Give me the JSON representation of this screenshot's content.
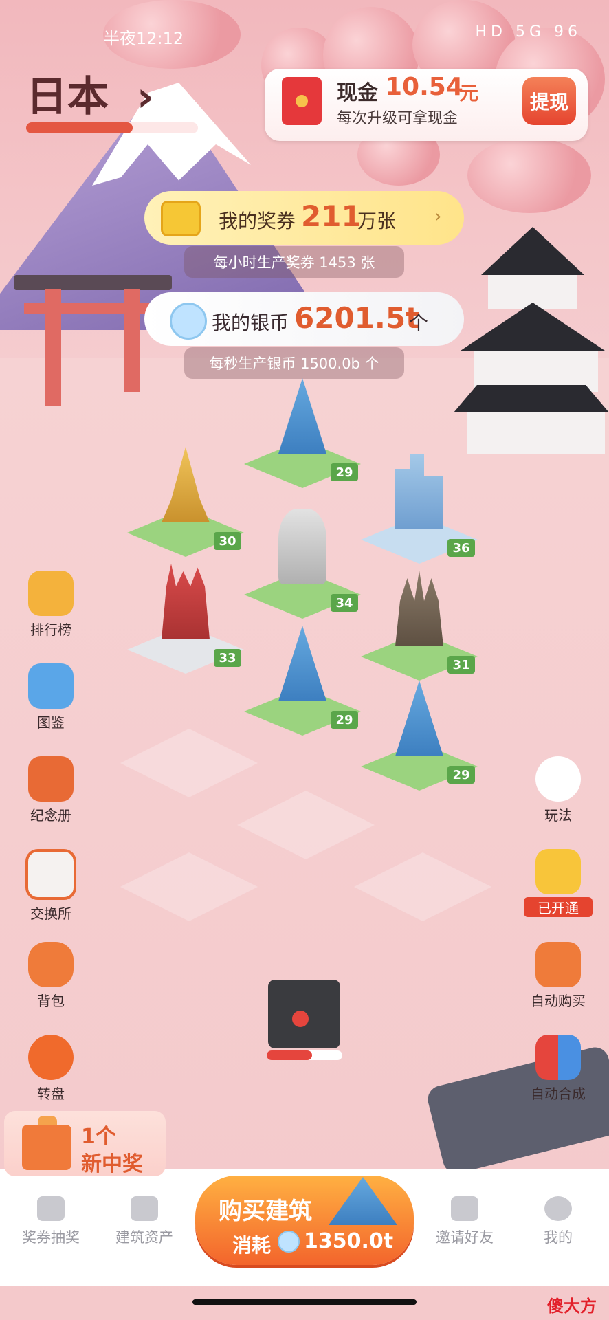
{
  "status_bar": {
    "time": "半夜12:12",
    "icons": "HD 5G 96"
  },
  "header": {
    "country": "日本",
    "arrow": "›",
    "progress": 0.62
  },
  "cash": {
    "label": "现金",
    "amount": "10.54",
    "unit": "元",
    "subtitle": "每次升级可拿现金",
    "withdraw_label": "提现"
  },
  "vouchers": {
    "label": "我的奖券",
    "amount": "211",
    "unit": "万张",
    "arrow": "›",
    "rate_text": "每小时生产奖券 1453 张"
  },
  "coins": {
    "label": "我的银币",
    "amount": "6201.5t",
    "unit": "个",
    "rate_text": "每秒生产银币 1500.0b 个"
  },
  "board": {
    "tiles": [
      {
        "level": "29",
        "kind": "pyramid-monument"
      },
      {
        "level": "30",
        "kind": "golden-stupa"
      },
      {
        "level": "36",
        "kind": "city-towers"
      },
      {
        "level": "34",
        "kind": "equestrian-statue"
      },
      {
        "level": "33",
        "kind": "kremlin"
      },
      {
        "level": "31",
        "kind": "angkor-wat"
      },
      {
        "level": "29",
        "kind": "pyramid-monument"
      },
      {
        "level": "29",
        "kind": "pyramid-monument"
      }
    ]
  },
  "left_menu": [
    {
      "label": "排行榜",
      "icon": "trophy-icon"
    },
    {
      "label": "图鉴",
      "icon": "album-icon"
    },
    {
      "label": "纪念册",
      "icon": "book-icon"
    },
    {
      "label": "交换所",
      "icon": "shop-icon"
    },
    {
      "label": "背包",
      "icon": "backpack-icon"
    },
    {
      "label": "转盘",
      "icon": "wheel-icon"
    }
  ],
  "right_menu": [
    {
      "label": "玩法",
      "icon": "gamepad-icon"
    },
    {
      "label": "已开通",
      "icon": "crown-icon"
    },
    {
      "label": "自动购买",
      "icon": "auto-buy-icon"
    },
    {
      "label": "自动合成",
      "icon": "auto-merge-icon"
    }
  ],
  "mystery_box": {
    "progress": 0.6
  },
  "gift": {
    "count": "1个",
    "text": "新中奖"
  },
  "buy": {
    "title": "购买建筑",
    "cost_label": "消耗",
    "cost": "1350.0t"
  },
  "bottom_nav": [
    {
      "label": "奖券抽奖",
      "icon": "lottery-icon"
    },
    {
      "label": "建筑资产",
      "icon": "assets-icon"
    },
    {
      "label": "邀请好友",
      "icon": "friends-icon"
    },
    {
      "label": "我的",
      "icon": "profile-icon"
    }
  ],
  "watermark": "傻大方",
  "colors": {
    "accent": "#e05c2f",
    "cash_button": "#e5442f",
    "buy_button": "#f3652c"
  }
}
